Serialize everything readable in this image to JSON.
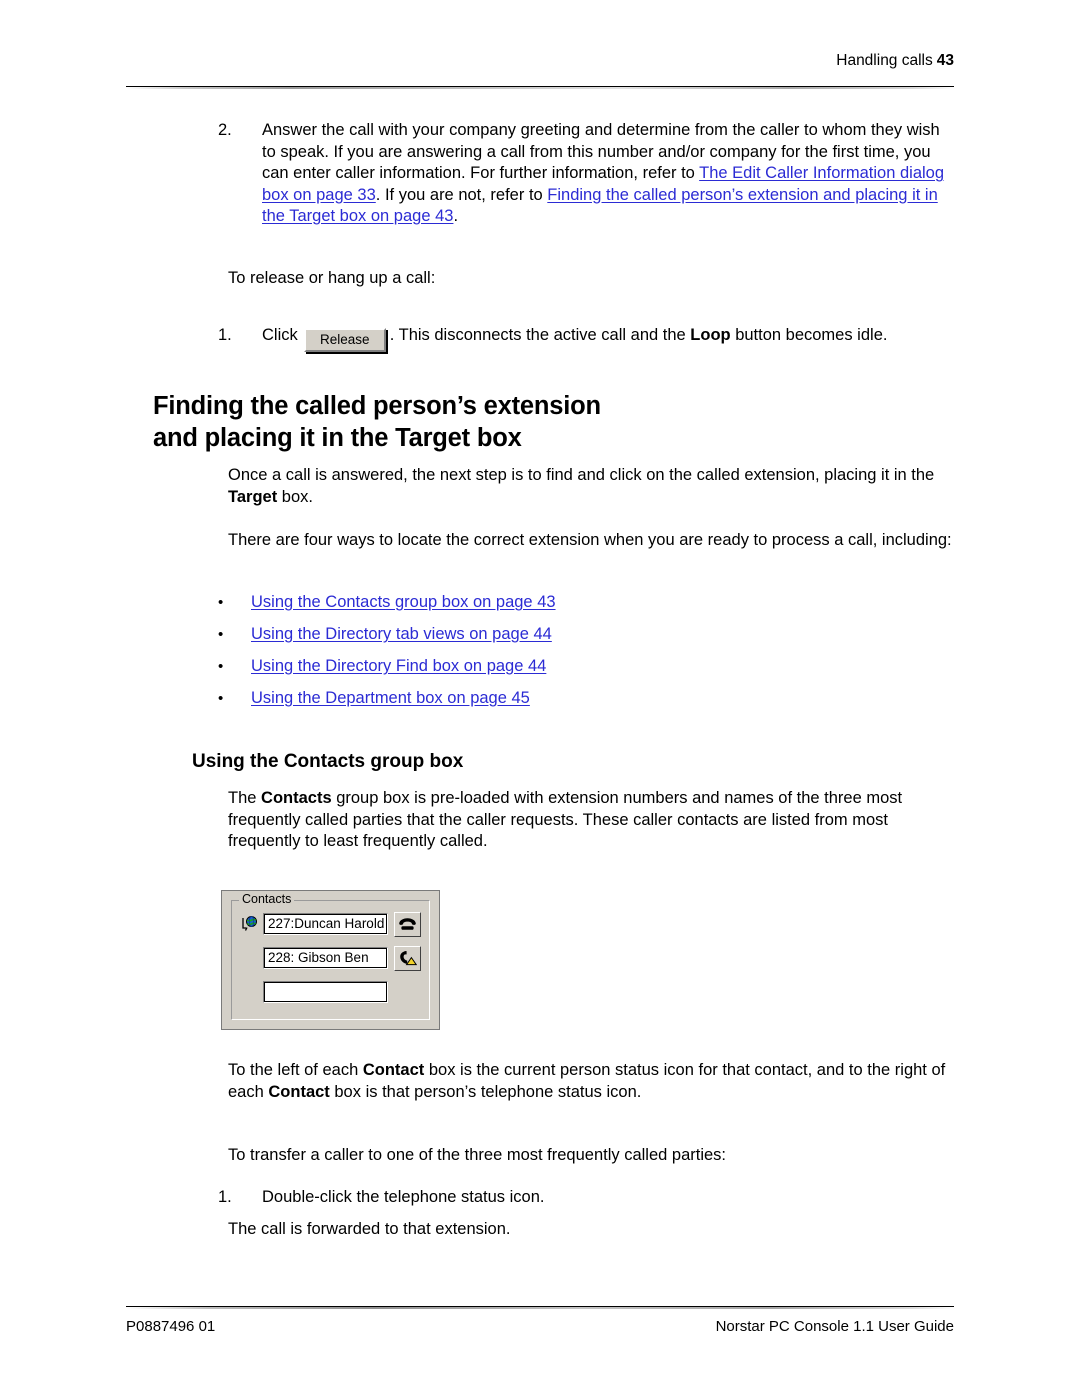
{
  "header": {
    "section_title": "Handling calls",
    "page_number": "43"
  },
  "footer": {
    "doc_code": "P0887496 01",
    "guide_title": "Norstar PC Console 1.1 User Guide"
  },
  "steps": {
    "step2_marker": "2.",
    "step2_text_part1": "Answer the call with your company greeting and determine from the caller to whom they wish to speak. If you are answering a call from this number and/or company for the first time, you can enter caller information. For further information, refer to ",
    "step2_link1": "The Edit Caller Information dialog box on page 33",
    "step2_text_part2": ". If you are not, refer to ",
    "step2_link2": "Finding the called person’s extension and placing it in the Target box on page 43",
    "step2_text_part3": "."
  },
  "release": {
    "intro": "To release or hang up a call:",
    "marker": "1.",
    "click_label": "Click",
    "button_label": "Release",
    "after_text_part1": ". This disconnects the active call and the ",
    "after_bold": "Loop",
    "after_text_part2": " button becomes idle."
  },
  "heading": {
    "h1_line1": "Finding the called person’s extension",
    "h1_line2": "and placing it in the Target box",
    "h2": "Using the Contacts group box"
  },
  "intro": {
    "para1_part1": "Once a call is answered, the next step is to find and click on the called extension, placing it in the ",
    "para1_bold": "Target",
    "para1_part2": " box.",
    "para2": "There are four ways to locate the correct extension when you are ready to process a call, including:"
  },
  "bullets": [
    {
      "marker": "•",
      "label": "Using the Contacts group box on page 43"
    },
    {
      "marker": "•",
      "label": "Using the Directory tab views on page 44"
    },
    {
      "marker": "•",
      "label": "Using the Directory Find box on page 44"
    },
    {
      "marker": "•",
      "label": "Using the Department box on page 45"
    }
  ],
  "contacts_section": {
    "para_part1": "The ",
    "para_bold": "Contacts",
    "para_part2": " group box is pre-loaded with extension numbers and names of the three most frequently called parties that the caller requests. These caller contacts are listed from most frequently to least frequently called."
  },
  "figure": {
    "groupbox_title": "Contacts",
    "rows": [
      {
        "person_status_icon": "globe-status-icon",
        "value": "227:Duncan Harold",
        "phone_status_icon": "telephone-onhook-icon"
      },
      {
        "person_status_icon": "none",
        "value": "228: Gibson Ben",
        "phone_status_icon": "telephone-offhook-alert-icon"
      },
      {
        "person_status_icon": "none",
        "value": "",
        "phone_status_icon": "none"
      }
    ]
  },
  "after_figure": {
    "para_part1": "To the left of each ",
    "para_bold1": "Contact",
    "para_part2": " box is the current person status icon for that contact, and to the right of each ",
    "para_bold2": "Contact",
    "para_part3": " box is that person’s telephone status icon."
  },
  "transfer": {
    "intro": "To transfer a caller to one of the three most frequently called parties:",
    "marker": "1.",
    "step_text": "Double-click the telephone status icon.",
    "result_text": "The call is forwarded to that extension."
  },
  "colors": {
    "link": "#2b2bd4",
    "dialog_face": "#d4d0c8",
    "alert_yellow": "#ffe34d"
  }
}
